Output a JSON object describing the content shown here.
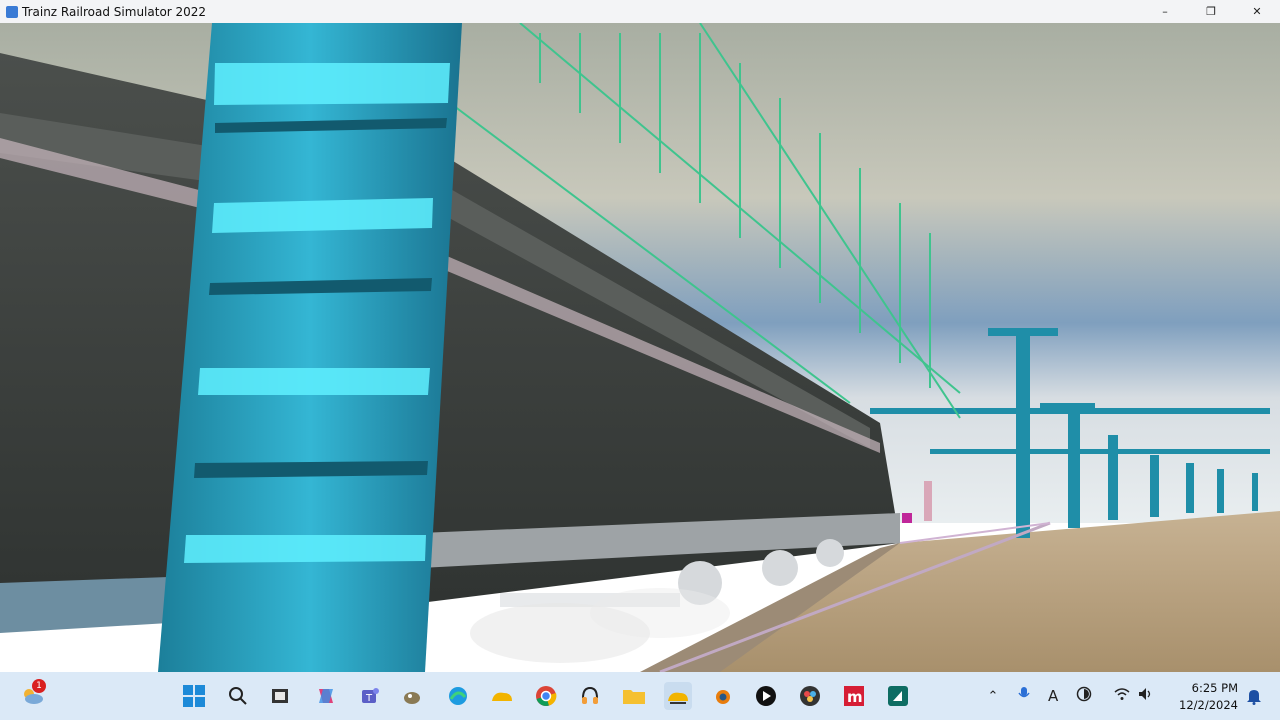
{
  "window": {
    "title": "Trainz Railroad Simulator 2022",
    "minimize": "–",
    "maximize": "❐",
    "close": "✕"
  },
  "taskbar": {
    "weather_badge": "1",
    "clock_time": "6:25 PM",
    "clock_date": "12/2/2024",
    "tray_input_label": "A"
  },
  "colors": {
    "sky_top": "#a9b2a6",
    "pillar": "#2aa9c9",
    "girder": "#3fc48e",
    "loco": "#3a3f3d",
    "ground": "#b59f7e"
  }
}
